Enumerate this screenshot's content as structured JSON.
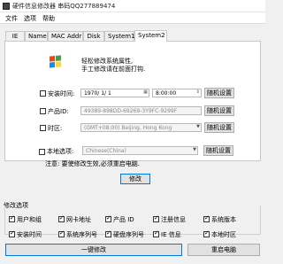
{
  "window": {
    "title": "硬件信息修改器 串码QQ277889474"
  },
  "menu": [
    "文件",
    "选项",
    "帮助"
  ],
  "tabs": [
    {
      "label": "IE",
      "active": false
    },
    {
      "label": "Name",
      "active": false
    },
    {
      "label": "MAC Addr",
      "active": false
    },
    {
      "label": "Disk",
      "active": false
    },
    {
      "label": "System1",
      "active": false
    },
    {
      "label": "System2",
      "active": true
    }
  ],
  "system2": {
    "info_line1": "轻松修改系统属性,",
    "info_line2": "手工修改请在前面打钩.",
    "install_time": {
      "label": "安装时间:",
      "checked": false,
      "date": "1970/ 1/ 1",
      "time": "8:00:00",
      "random_button": "随机设置"
    },
    "product_id": {
      "label": "产品ID:",
      "checked": false,
      "value": "49389-898DD-69269-3Y9FC-9299F",
      "random_button": "随机设置"
    },
    "timezone": {
      "label": "时区:",
      "checked": false,
      "value": "(GMT+08:00) Beijing, Hong Kong",
      "random_button": "随机设置"
    },
    "locale": {
      "label": "本地选项:",
      "checked": false,
      "value": "Chinese(China)",
      "random_button": "随机设置"
    },
    "note": "注意: 要使修改生效,必须重启电脑.",
    "modify_button": "修改"
  },
  "options": {
    "title": "修改选项",
    "row1": [
      {
        "label": "用户和组",
        "checked": true
      },
      {
        "label": "网卡地址",
        "checked": true
      },
      {
        "label": "产品 ID",
        "checked": true
      },
      {
        "label": "注册信息",
        "checked": true
      },
      {
        "label": "系统版本",
        "checked": true
      }
    ],
    "row2": [
      {
        "label": "安装时间",
        "checked": true
      },
      {
        "label": "系统序列号",
        "checked": true
      },
      {
        "label": "硬盘序列号",
        "checked": true
      },
      {
        "label": "IE 信息",
        "checked": true
      },
      {
        "label": "本地时区",
        "checked": true
      }
    ]
  },
  "footer": {
    "modify_all_button": "一键修改",
    "restart_button": "重启电脑"
  },
  "icons": {
    "logo": "windows-logo-icon",
    "app": "app-icon"
  }
}
